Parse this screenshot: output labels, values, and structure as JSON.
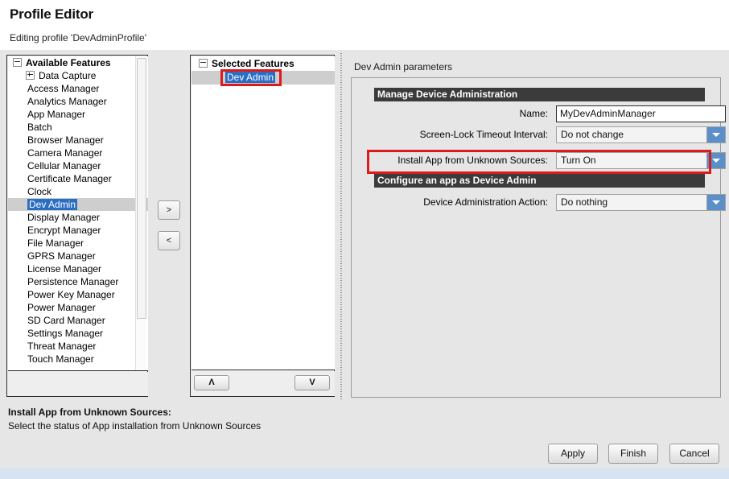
{
  "window": {
    "title": "Profile Editor",
    "subtitle": "Editing profile 'DevAdminProfile'"
  },
  "available_features": {
    "root_label": "Available Features",
    "items": [
      {
        "label": "Data Capture",
        "expandable": true,
        "selected": false
      },
      {
        "label": "Access Manager",
        "expandable": false,
        "selected": false
      },
      {
        "label": "Analytics Manager",
        "expandable": false,
        "selected": false
      },
      {
        "label": "App Manager",
        "expandable": false,
        "selected": false
      },
      {
        "label": "Batch",
        "expandable": false,
        "selected": false
      },
      {
        "label": "Browser Manager",
        "expandable": false,
        "selected": false
      },
      {
        "label": "Camera Manager",
        "expandable": false,
        "selected": false
      },
      {
        "label": "Cellular Manager",
        "expandable": false,
        "selected": false
      },
      {
        "label": "Certificate Manager",
        "expandable": false,
        "selected": false
      },
      {
        "label": "Clock",
        "expandable": false,
        "selected": false
      },
      {
        "label": "Dev Admin",
        "expandable": false,
        "selected": true
      },
      {
        "label": "Display Manager",
        "expandable": false,
        "selected": false
      },
      {
        "label": "Encrypt Manager",
        "expandable": false,
        "selected": false
      },
      {
        "label": "File Manager",
        "expandable": false,
        "selected": false
      },
      {
        "label": "GPRS Manager",
        "expandable": false,
        "selected": false
      },
      {
        "label": "License Manager",
        "expandable": false,
        "selected": false
      },
      {
        "label": "Persistence Manager",
        "expandable": false,
        "selected": false
      },
      {
        "label": "Power Key Manager",
        "expandable": false,
        "selected": false
      },
      {
        "label": "Power Manager",
        "expandable": false,
        "selected": false
      },
      {
        "label": "SD Card Manager",
        "expandable": false,
        "selected": false
      },
      {
        "label": "Settings Manager",
        "expandable": false,
        "selected": false
      },
      {
        "label": "Threat Manager",
        "expandable": false,
        "selected": false
      },
      {
        "label": "Touch Manager",
        "expandable": false,
        "selected": false
      }
    ]
  },
  "transfer_buttons": {
    "add_label": ">",
    "remove_label": "<"
  },
  "selected_features": {
    "root_label": "Selected Features",
    "items": [
      "Dev Admin"
    ],
    "move_up_label": "Λ",
    "move_down_label": "V"
  },
  "parameters": {
    "title": "Dev Admin parameters",
    "sections": [
      {
        "header": "Manage Device Administration",
        "fields": [
          {
            "label": "Name:",
            "type": "text",
            "value": "MyDevAdminManager"
          },
          {
            "label": "Screen-Lock Timeout Interval:",
            "type": "combo",
            "value": "Do not change"
          },
          {
            "label": "Install App from Unknown Sources:",
            "type": "combo",
            "value": "Turn On",
            "highlighted": true
          }
        ]
      },
      {
        "header": "Configure an app as Device Admin",
        "fields": [
          {
            "label": "Device Administration Action:",
            "type": "combo",
            "value": "Do nothing"
          }
        ]
      }
    ]
  },
  "help": {
    "title": "Install App from Unknown Sources:",
    "description": "Select the status of App installation from Unknown Sources"
  },
  "footer": {
    "apply_label": "Apply",
    "finish_label": "Finish",
    "cancel_label": "Cancel"
  },
  "colors": {
    "selection_blue": "#2a6ec4",
    "row_gray": "#cecece",
    "section_header": "#3b3b3b",
    "combo_arrow_blue": "#5b8fc9",
    "annotation_red": "#dd1b1b",
    "panel_bg": "#e6e6e6",
    "bottom_strip": "#d6e3f0"
  }
}
